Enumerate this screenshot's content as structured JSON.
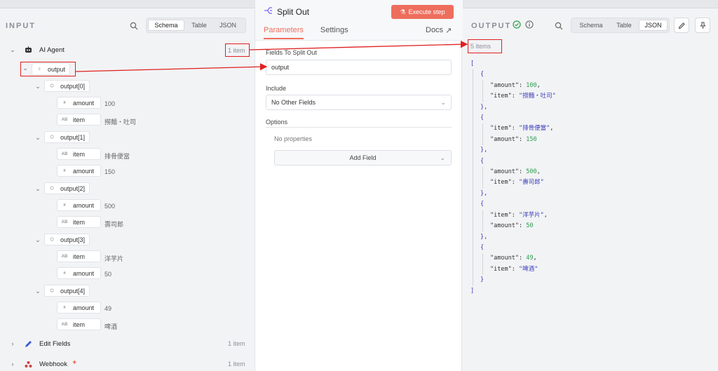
{
  "input": {
    "title": "INPUT",
    "view_tabs": [
      "Schema",
      "Table",
      "JSON"
    ],
    "active_tab": "Schema",
    "nodes": [
      {
        "name": "AI Agent",
        "count": "1 item"
      },
      {
        "name": "Edit Fields",
        "count": "1 item"
      },
      {
        "name": "Webhook",
        "count": "1 item"
      }
    ],
    "schema": {
      "root": "output",
      "groups": [
        {
          "name": "output[0]",
          "fields": [
            {
              "type": "#",
              "key": "amount",
              "value": "100"
            },
            {
              "type": "AB",
              "key": "item",
              "value": "撈麵・吐司"
            }
          ]
        },
        {
          "name": "output[1]",
          "fields": [
            {
              "type": "AB",
              "key": "item",
              "value": "排骨便當"
            },
            {
              "type": "#",
              "key": "amount",
              "value": "150"
            }
          ]
        },
        {
          "name": "output[2]",
          "fields": [
            {
              "type": "#",
              "key": "amount",
              "value": "500"
            },
            {
              "type": "AB",
              "key": "item",
              "value": "壽司郎"
            }
          ]
        },
        {
          "name": "output[3]",
          "fields": [
            {
              "type": "AB",
              "key": "item",
              "value": "洋芋片"
            },
            {
              "type": "#",
              "key": "amount",
              "value": "50"
            }
          ]
        },
        {
          "name": "output[4]",
          "fields": [
            {
              "type": "#",
              "key": "amount",
              "value": "49"
            },
            {
              "type": "AB",
              "key": "item",
              "value": "啤酒"
            }
          ]
        }
      ]
    }
  },
  "node": {
    "title": "Split Out",
    "execute_label": "Execute step",
    "tabs": [
      "Parameters",
      "Settings"
    ],
    "active_tab": "Parameters",
    "docs_label": "Docs",
    "fields_label": "Fields To Split Out",
    "fields_value": "output",
    "include_label": "Include",
    "include_value": "No Other Fields",
    "options_label": "Options",
    "no_properties": "No properties",
    "add_field_label": "Add Field"
  },
  "output": {
    "title": "OUTPUT",
    "view_tabs": [
      "Schema",
      "Table",
      "JSON"
    ],
    "active_tab": "JSON",
    "count": "5 items",
    "items": [
      {
        "k1": "\"amount\"",
        "v1": "100",
        "k2": "\"item\"",
        "v2": "\"撈麵・吐司\""
      },
      {
        "k1": "\"item\"",
        "v1": "\"排骨便當\"",
        "k2": "\"amount\"",
        "v2": "150"
      },
      {
        "k1": "\"amount\"",
        "v1": "500",
        "k2": "\"item\"",
        "v2": "\"壽司郎\""
      },
      {
        "k1": "\"item\"",
        "v1": "\"洋芋片\"",
        "k2": "\"amount\"",
        "v2": "50"
      },
      {
        "k1": "\"amount\"",
        "v1": "49",
        "k2": "\"item\"",
        "v2": "\"啤酒\""
      }
    ]
  },
  "colors": {
    "accent": "#ee6e5d",
    "annotation": "#e02020",
    "json_number": "#2e9e4f",
    "json_string": "#3b3bb8",
    "success": "#2e9e4f"
  }
}
